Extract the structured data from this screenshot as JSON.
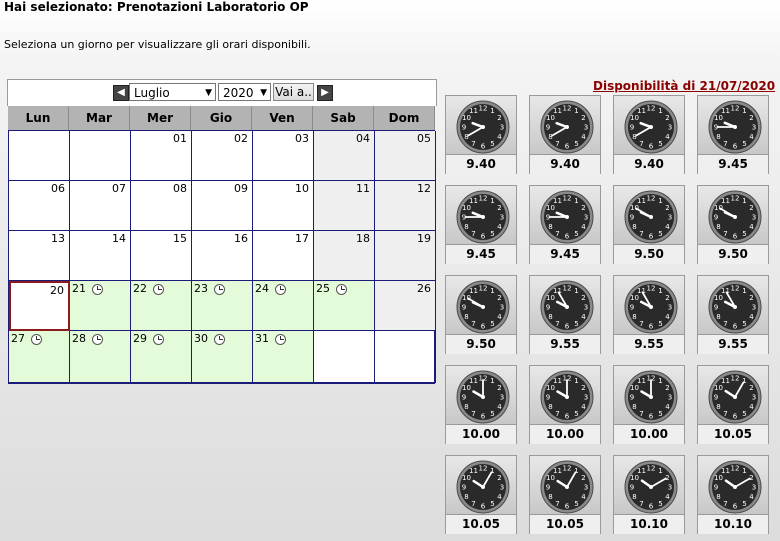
{
  "header": {
    "title": "Hai selezionato: Prenotazioni Laboratorio OP",
    "instruction": "Seleziona un giorno per visualizzare gli orari disponibili."
  },
  "calendar": {
    "prev_icon": "arrow-left-icon",
    "next_icon": "arrow-right-icon",
    "month": "Luglio",
    "year": "2020",
    "go_label": "Vai a..",
    "weekdays": [
      "Lun",
      "Mar",
      "Mer",
      "Gio",
      "Ven",
      "Sab",
      "Dom"
    ],
    "weeks": [
      [
        {
          "n": ""
        },
        {
          "n": ""
        },
        {
          "n": "01"
        },
        {
          "n": "02"
        },
        {
          "n": "03"
        },
        {
          "n": "04",
          "w": true
        },
        {
          "n": "05",
          "w": true
        }
      ],
      [
        {
          "n": "06"
        },
        {
          "n": "07"
        },
        {
          "n": "08"
        },
        {
          "n": "09"
        },
        {
          "n": "10"
        },
        {
          "n": "11",
          "w": true
        },
        {
          "n": "12",
          "w": true
        }
      ],
      [
        {
          "n": "13"
        },
        {
          "n": "14"
        },
        {
          "n": "15"
        },
        {
          "n": "16"
        },
        {
          "n": "17"
        },
        {
          "n": "18",
          "w": true
        },
        {
          "n": "19",
          "w": true
        }
      ],
      [
        {
          "n": "20",
          "sel": true
        },
        {
          "n": "21",
          "a": true
        },
        {
          "n": "22",
          "a": true
        },
        {
          "n": "23",
          "a": true
        },
        {
          "n": "24",
          "a": true
        },
        {
          "n": "25",
          "a": true
        },
        {
          "n": "26",
          "w": true
        }
      ],
      [
        {
          "n": "27",
          "a": true
        },
        {
          "n": "28",
          "a": true
        },
        {
          "n": "29",
          "a": true
        },
        {
          "n": "30",
          "a": true
        },
        {
          "n": "31",
          "a": true
        },
        {
          "n": ""
        },
        {
          "n": ""
        }
      ]
    ],
    "colors": {
      "available": "#e4fbd9",
      "weekend": "#efefef",
      "selected_border": "#8b1a1a",
      "grid": "#1b1b7a"
    }
  },
  "availability": {
    "title": "Disponibilità di 21/07/2020",
    "slots": [
      "9.40",
      "9.40",
      "9.40",
      "9.45",
      "9.45",
      "9.45",
      "9.50",
      "9.50",
      "9.50",
      "9.55",
      "9.55",
      "9.55",
      "10.00",
      "10.00",
      "10.00",
      "10.05",
      "10.05",
      "10.05",
      "10.10",
      "10.10"
    ]
  }
}
